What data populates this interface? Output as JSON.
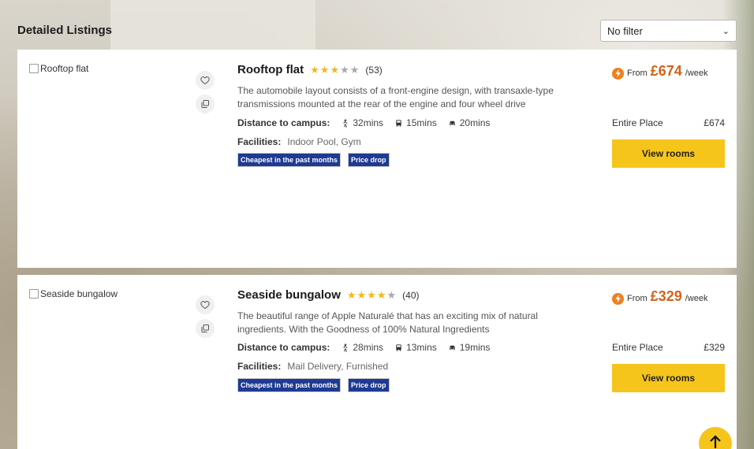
{
  "header": {
    "title": "Detailed Listings"
  },
  "filter": {
    "selected": "No filter"
  },
  "listings": [
    {
      "image_alt": "Rooftop flat",
      "title": "Rooftop flat",
      "rating": 3,
      "rating_max": 5,
      "reviews": "(53)",
      "description": "The automobile layout consists of a front-engine design, with transaxle-type transmissions mounted at the rear of the engine and four wheel drive",
      "distance_label": "Distance to campus:",
      "walk": "32mins",
      "bus": "15mins",
      "car": "20mins",
      "facilities_label": "Facilities:",
      "facilities": "Indoor Pool, Gym",
      "badges": [
        "Cheapest in the past months",
        "Price drop"
      ],
      "from_label": "From",
      "price": "£674",
      "per": "/week",
      "place_type": "Entire Place",
      "place_price": "£674",
      "button": "View rooms"
    },
    {
      "image_alt": "Seaside bungalow",
      "title": "Seaside bungalow",
      "rating": 4,
      "rating_max": 5,
      "reviews": "(40)",
      "description": "The beautiful range of Apple Naturalé that has an exciting mix of natural ingredients. With the Goodness of 100% Natural Ingredients",
      "distance_label": "Distance to campus:",
      "walk": "28mins",
      "bus": "13mins",
      "car": "19mins",
      "facilities_label": "Facilities:",
      "facilities": "Mail Delivery, Furnished",
      "badges": [
        "Cheapest in the past months",
        "Price drop"
      ],
      "from_label": "From",
      "price": "£329",
      "per": "/week",
      "place_type": "Entire Place",
      "place_price": "£329",
      "button": "View rooms"
    }
  ],
  "colors": {
    "accent": "#f6c51c",
    "price": "#d4621a",
    "badge": "#1f3a93",
    "star": "#f3b71b"
  },
  "icons": [
    "heart-icon",
    "compare-icon",
    "walk-icon",
    "bus-icon",
    "car-icon",
    "bolt-icon",
    "arrow-up-icon"
  ]
}
